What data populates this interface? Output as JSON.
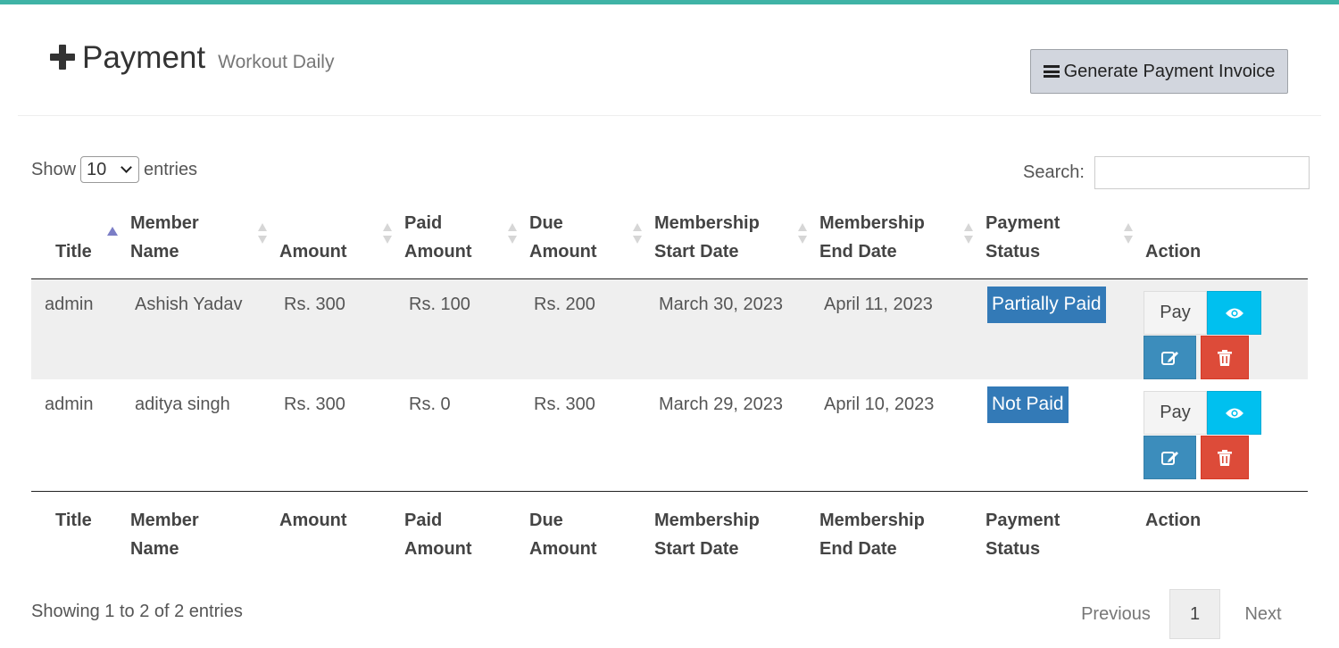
{
  "header": {
    "title": "Payment",
    "subtitle": "Workout Daily",
    "generate_button_label": "Generate Payment Invoice"
  },
  "controls": {
    "show_label": "Show",
    "page_length": "10",
    "entries_label": "entries",
    "search_label": "Search:",
    "search_value": ""
  },
  "table": {
    "columns": [
      {
        "line1": "",
        "line2": "Title"
      },
      {
        "line1": "Member",
        "line2": "Name"
      },
      {
        "line1": "",
        "line2": "Amount"
      },
      {
        "line1": "Paid",
        "line2": "Amount"
      },
      {
        "line1": "Due",
        "line2": "Amount"
      },
      {
        "line1": "Membership",
        "line2": "Start Date"
      },
      {
        "line1": "Membership",
        "line2": "End Date"
      },
      {
        "line1": "Payment",
        "line2": "Status"
      },
      {
        "line1": "",
        "line2": "Action"
      }
    ],
    "footer_columns": [
      {
        "line1": "Title",
        "line2": ""
      },
      {
        "line1": "Member",
        "line2": "Name"
      },
      {
        "line1": "Amount",
        "line2": ""
      },
      {
        "line1": "Paid",
        "line2": "Amount"
      },
      {
        "line1": "Due",
        "line2": "Amount"
      },
      {
        "line1": "Membership",
        "line2": "Start Date"
      },
      {
        "line1": "Membership",
        "line2": "End Date"
      },
      {
        "line1": "Payment",
        "line2": "Status"
      },
      {
        "line1": "Action",
        "line2": ""
      }
    ],
    "rows": [
      {
        "title": "admin",
        "member_name": "Ashish Yadav",
        "amount": "Rs. 300",
        "paid_amount": "Rs. 100",
        "due_amount": "Rs. 200",
        "start_date": "March 30, 2023",
        "end_date": "April 11, 2023",
        "status": "Partially Paid",
        "pay_label": "Pay"
      },
      {
        "title": "admin",
        "member_name": "aditya singh",
        "amount": "Rs. 300",
        "paid_amount": "Rs. 0",
        "due_amount": "Rs. 300",
        "start_date": "March 29, 2023",
        "end_date": "April 10, 2023",
        "status": "Not Paid",
        "pay_label": "Pay"
      }
    ]
  },
  "footer": {
    "info": "Showing 1 to 2 of 2 entries",
    "previous_label": "Previous",
    "current_page": "1",
    "next_label": "Next"
  },
  "colors": {
    "top_bar": "#3fb3a6",
    "status_badge": "#337ab7",
    "view_button": "#00c0ef",
    "edit_button": "#3c8dbc",
    "delete_button": "#dd4b39"
  },
  "icons": {
    "title_icon": "plus-icon",
    "generate_icon": "bars-icon",
    "view_icon": "eye-icon",
    "edit_icon": "edit-icon",
    "delete_icon": "trash-icon"
  }
}
